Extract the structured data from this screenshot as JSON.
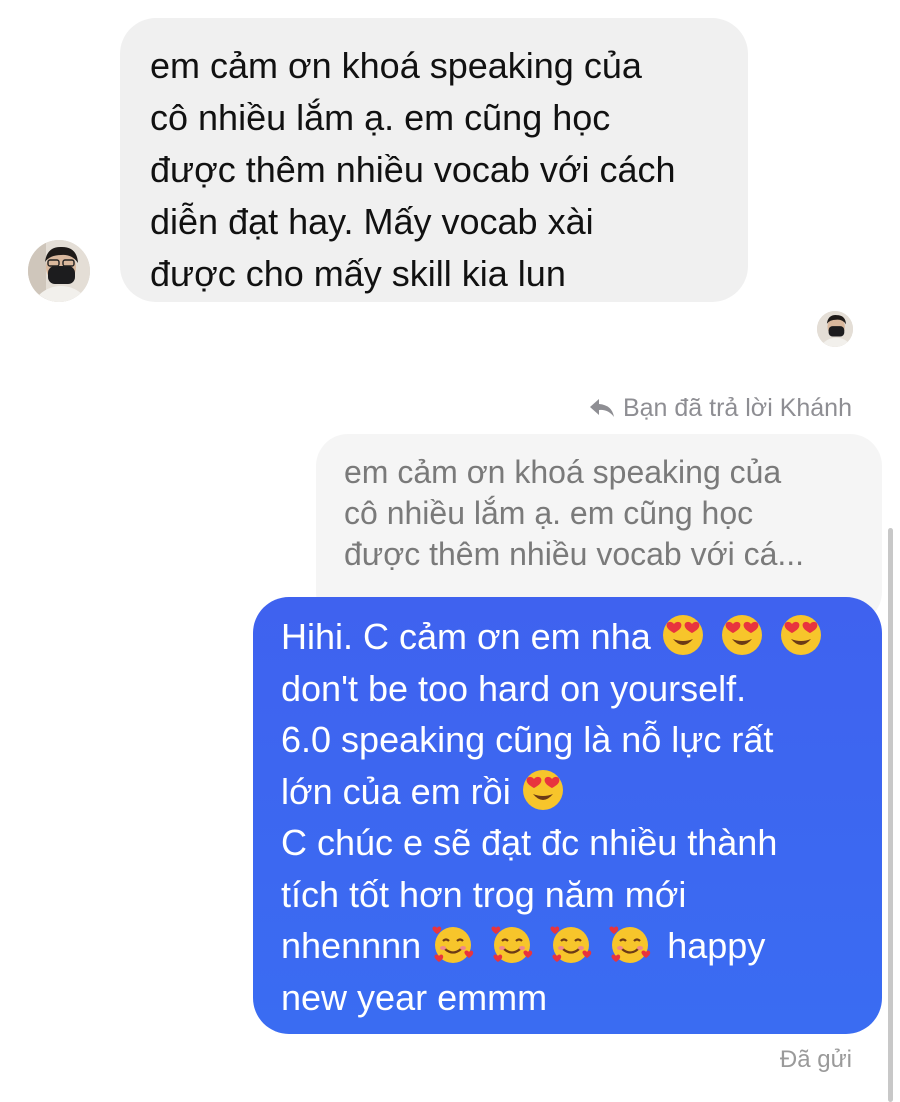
{
  "incoming": {
    "lines": [
      "em cảm ơn khoá speaking của",
      "cô nhiều lắm ạ. em cũng học",
      "được thêm nhiều vocab với cách",
      "diễn đạt hay. Mấy vocab xài",
      "được cho mấy skill kia lun"
    ],
    "avatar_icon": "user-avatar-icon"
  },
  "seen_avatar_icon": "seen-avatar-icon",
  "reply_header": {
    "icon": "reply-arrow-icon",
    "text": "Bạn đã trả lời Khánh"
  },
  "quoted": {
    "lines": [
      "em cảm ơn khoá speaking của",
      "cô nhiều lắm ạ. em cũng học",
      "được thêm nhiều vocab với cá..."
    ]
  },
  "outgoing": {
    "line1_text": "Hihi. C cảm ơn em nha",
    "line2": "don't be too hard on yourself.",
    "line3": "6.0 speaking cũng là nỗ lực rất",
    "line4_text": "lớn của em rồi",
    "line5": "C chúc e sẽ đạt đc nhiều thành",
    "line6": "tích tốt hơn trog năm mới",
    "line7_text": "nhennnn",
    "line7_tail": "happy",
    "line8": "new year emmm",
    "emoji_heart_eyes": "😍",
    "emoji_smiling_hearts": "🥰"
  },
  "status": "Đã gửi",
  "colors": {
    "incoming_bg": "#f0f0f0",
    "outgoing_bg": "#3c6cf0",
    "quoted_text": "#7a7a7a",
    "meta_text": "#8e8e93"
  }
}
